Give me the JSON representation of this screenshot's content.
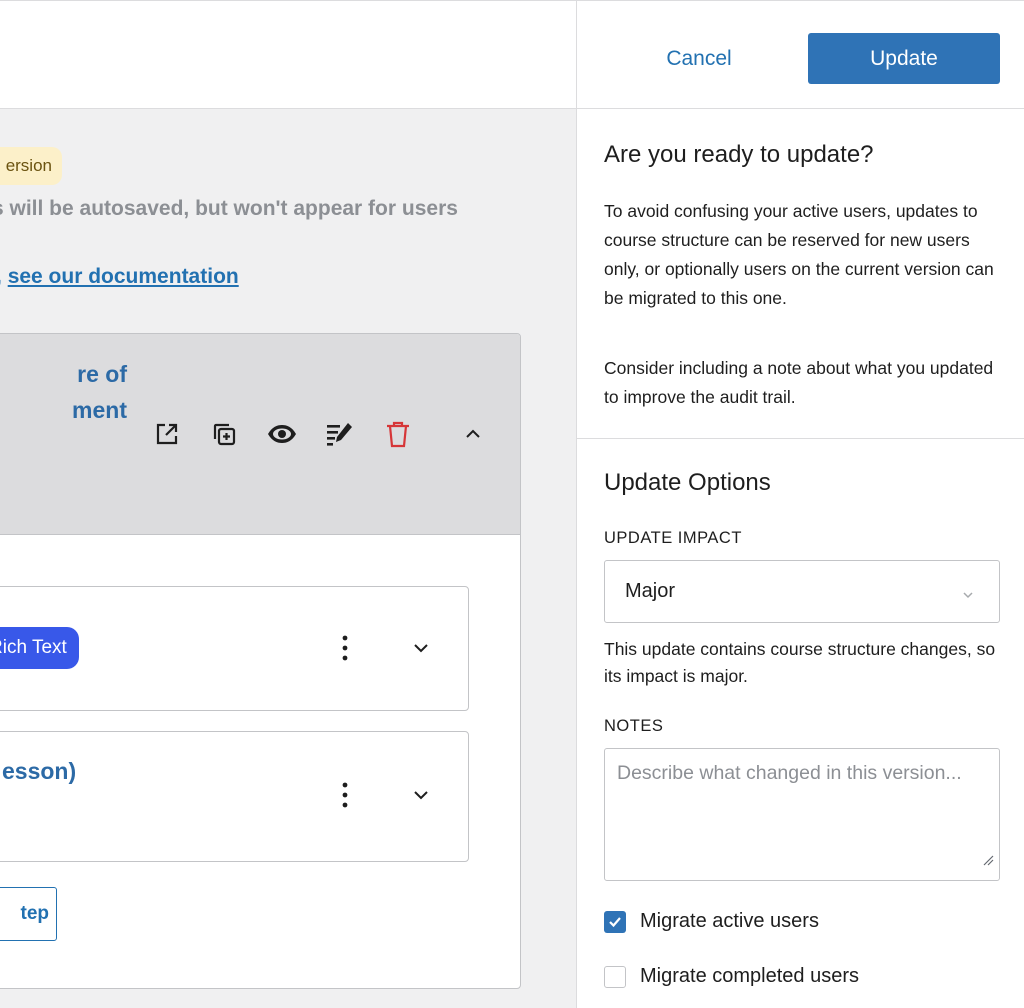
{
  "header": {
    "cancel_label": "Cancel",
    "update_label": "Update"
  },
  "editor": {
    "version_badge": "ersion",
    "autosave_notice": "s will be autosaved, but won't appear for users",
    "doc_prefix": ",",
    "doc_link": "see our documentation",
    "module": {
      "title": "re of\nment",
      "action_icons": [
        "external-link-icon",
        "duplicate-icon",
        "eye-icon",
        "edit-list-icon",
        "trash-icon",
        "chevron-up-icon"
      ]
    },
    "steps": [
      {
        "pill_label": "Rich Text",
        "title": ""
      },
      {
        "pill_label": "",
        "title": "esson)"
      }
    ],
    "add_step_label": "tep"
  },
  "panel": {
    "ready_heading": "Are you ready to update?",
    "ready_text_1": "To avoid confusing your active users, updates to course structure can be reserved for new users only, or optionally users on the current version can be migrated to this one.",
    "ready_text_2": "Consider including a note about what you updated to improve the audit trail.",
    "options_heading": "Update Options",
    "impact_label": "UPDATE IMPACT",
    "impact_value": "Major",
    "impact_help": "This update contains course structure changes, so its impact is major.",
    "notes_label": "NOTES",
    "notes_placeholder": "Describe what changed in this version...",
    "migrate_active_label": "Migrate active users",
    "migrate_active_checked": true,
    "migrate_completed_label": "Migrate completed users",
    "migrate_completed_checked": false
  },
  "colors": {
    "accent": "#2f73b6",
    "link": "#2271b1",
    "danger": "#d63638",
    "pill": "#3858e9",
    "badge_bg": "#fcf0c9"
  }
}
